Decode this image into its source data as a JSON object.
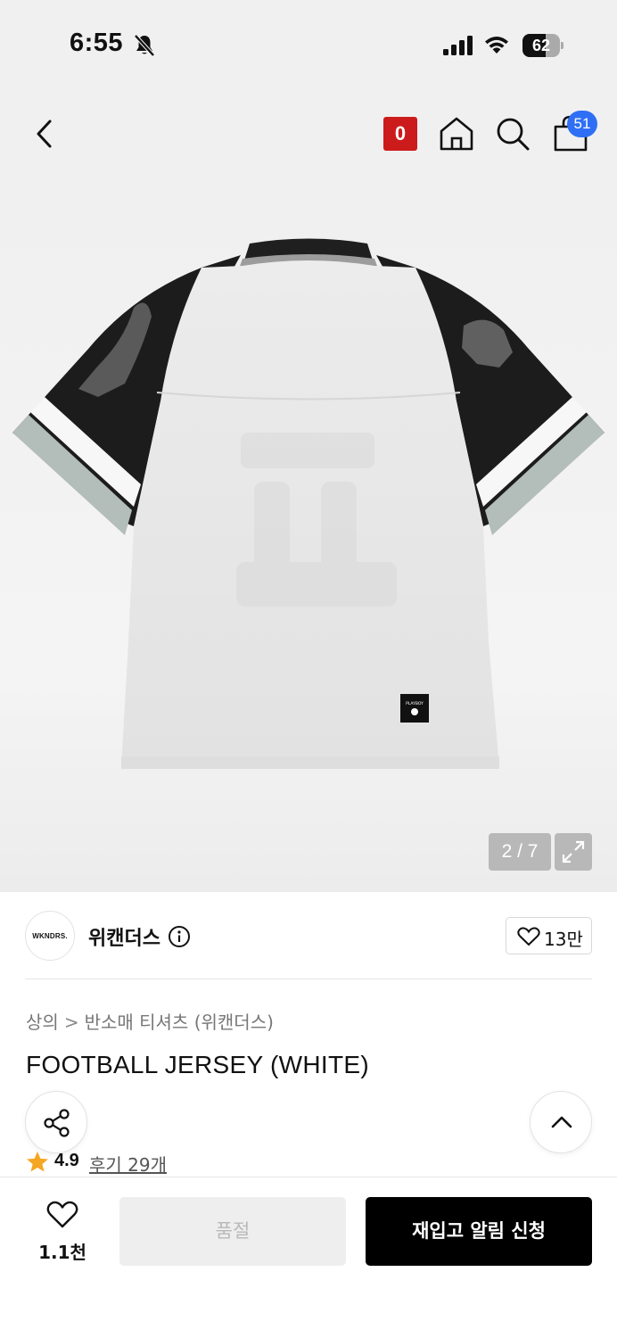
{
  "status_bar": {
    "time": "6:55",
    "battery": "62",
    "battery_level": 0.62
  },
  "header": {
    "counter_badge": "0",
    "cart_count": "51"
  },
  "gallery": {
    "counter": "2 / 7",
    "label_text": "PLAYBOY"
  },
  "brand": {
    "logo_text": "WKNDRS.",
    "name": "위캔더스",
    "likes": "13만"
  },
  "breadcrumb": {
    "category": "상의",
    "separator": ">",
    "subcategory": "반소매 티셔츠 (위캔더스)"
  },
  "product": {
    "title": "FOOTBALL JERSEY (WHITE)",
    "rating": "4.9",
    "reviews": "후기 29개"
  },
  "bottom_bar": {
    "wish_count": "1.1천",
    "soldout_label": "품절",
    "restock_label": "재입고 알림 신청"
  },
  "colors": {
    "accent_red": "#cc1b1b",
    "cart_badge_blue": "#2f6ff5",
    "star_orange": "#f5a623",
    "primary_black": "#000000"
  }
}
